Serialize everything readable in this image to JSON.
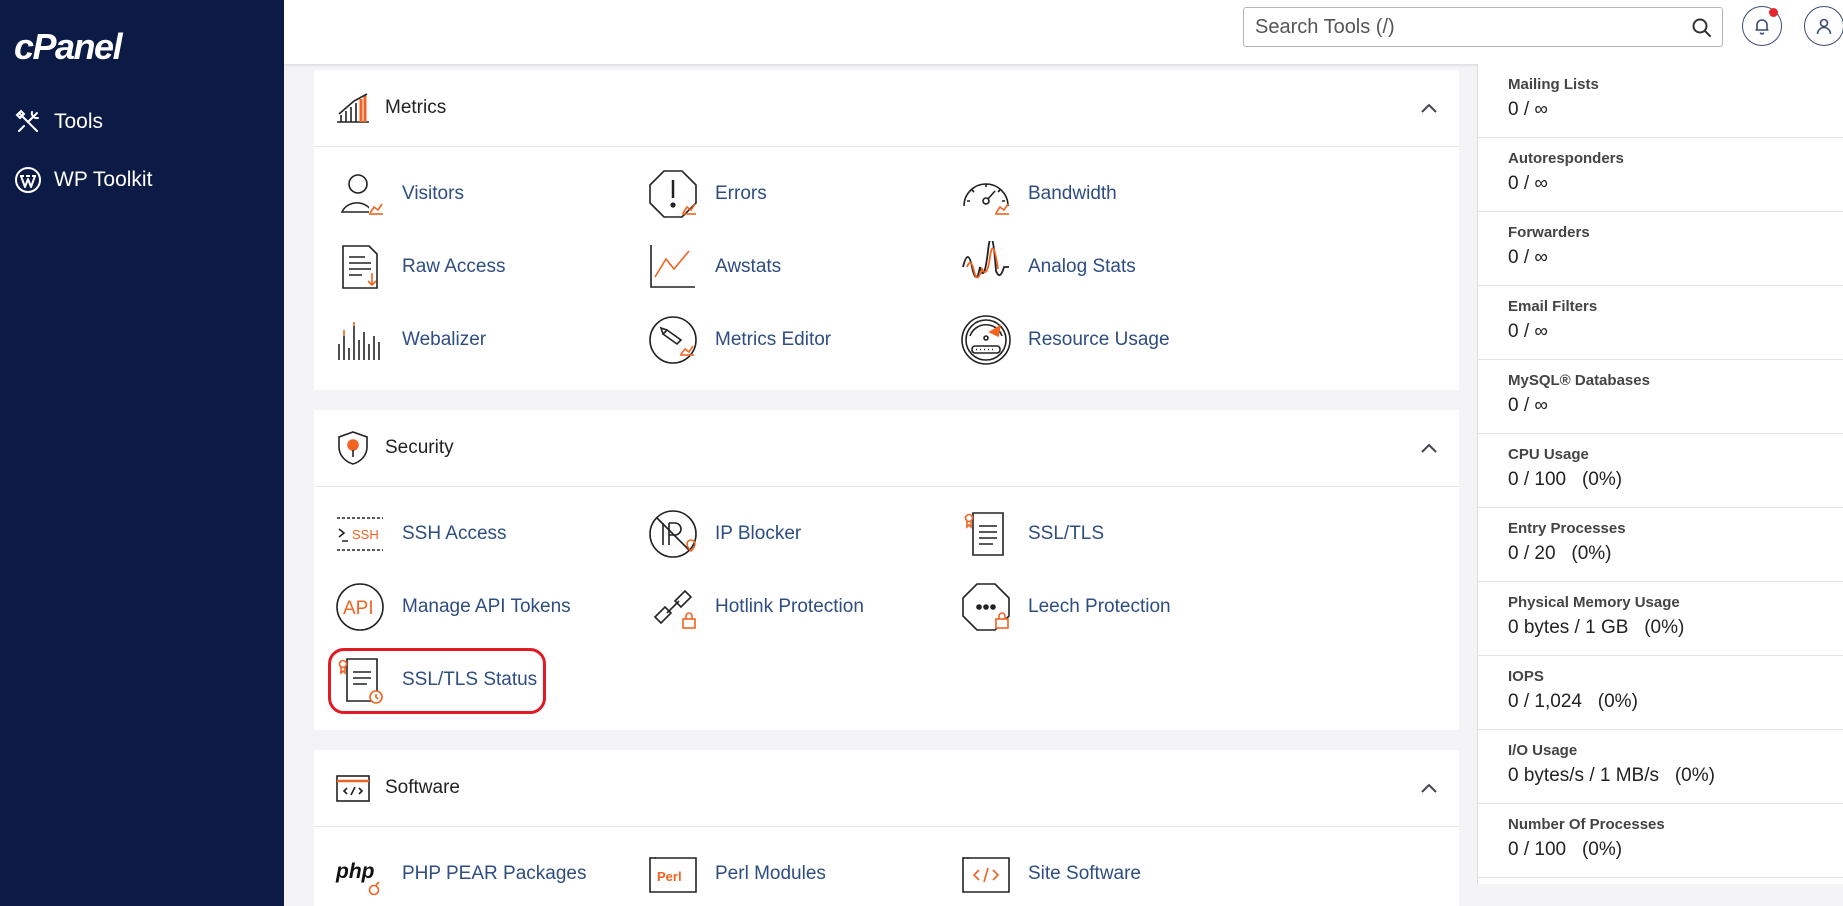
{
  "app": {
    "logo_text": "cPanel"
  },
  "sidebar": {
    "items": [
      {
        "label": "Tools",
        "icon": "tools-icon"
      },
      {
        "label": "WP Toolkit",
        "icon": "wordpress-icon"
      }
    ]
  },
  "search": {
    "placeholder": "Search Tools (/)",
    "value": ""
  },
  "header": {
    "notification_icon": "bell-icon",
    "user_icon": "user-icon"
  },
  "colors": {
    "sidebar_bg": "#0b1b45",
    "accent": "#f26322",
    "link": "#2e4d83",
    "highlight": "#e01b24"
  },
  "sections": [
    {
      "title": "Metrics",
      "tools": [
        {
          "label": "Visitors",
          "icon": "visitors-icon"
        },
        {
          "label": "Errors",
          "icon": "errors-icon"
        },
        {
          "label": "Bandwidth",
          "icon": "bandwidth-icon"
        },
        {
          "label": "Raw Access",
          "icon": "raw-access-icon"
        },
        {
          "label": "Awstats",
          "icon": "awstats-icon"
        },
        {
          "label": "Analog Stats",
          "icon": "analog-stats-icon"
        },
        {
          "label": "Webalizer",
          "icon": "webalizer-icon"
        },
        {
          "label": "Metrics Editor",
          "icon": "metrics-editor-icon"
        },
        {
          "label": "Resource Usage",
          "icon": "resource-usage-icon"
        }
      ]
    },
    {
      "title": "Security",
      "tools": [
        {
          "label": "SSH Access",
          "icon": "ssh-icon"
        },
        {
          "label": "IP Blocker",
          "icon": "ip-blocker-icon"
        },
        {
          "label": "SSL/TLS",
          "icon": "ssl-tls-icon"
        },
        {
          "label": "Manage API Tokens",
          "icon": "api-icon"
        },
        {
          "label": "Hotlink Protection",
          "icon": "hotlink-icon"
        },
        {
          "label": "Leech Protection",
          "icon": "leech-icon"
        },
        {
          "label": "SSL/TLS Status",
          "icon": "ssl-status-icon"
        }
      ]
    },
    {
      "title": "Software",
      "tools": [
        {
          "label": "PHP PEAR Packages",
          "icon": "php-icon"
        },
        {
          "label": "Perl Modules",
          "icon": "perl-icon"
        },
        {
          "label": "Site Software",
          "icon": "site-software-icon"
        }
      ]
    }
  ],
  "stats": [
    {
      "label": "Mailing Lists",
      "value": "0 / ∞"
    },
    {
      "label": "Autoresponders",
      "value": "0 / ∞"
    },
    {
      "label": "Forwarders",
      "value": "0 / ∞"
    },
    {
      "label": "Email Filters",
      "value": "0 / ∞"
    },
    {
      "label": "MySQL® Databases",
      "value": "0 / ∞"
    },
    {
      "label": "CPU Usage",
      "value": "0 / 100   (0%)"
    },
    {
      "label": "Entry Processes",
      "value": "0 / 20   (0%)"
    },
    {
      "label": "Physical Memory Usage",
      "value": "0 bytes / 1 GB   (0%)"
    },
    {
      "label": "IOPS",
      "value": "0 / 1,024   (0%)"
    },
    {
      "label": "I/O Usage",
      "value": "0 bytes/s / 1 MB/s   (0%)"
    },
    {
      "label": "Number Of Processes",
      "value": "0 / 100   (0%)"
    }
  ]
}
